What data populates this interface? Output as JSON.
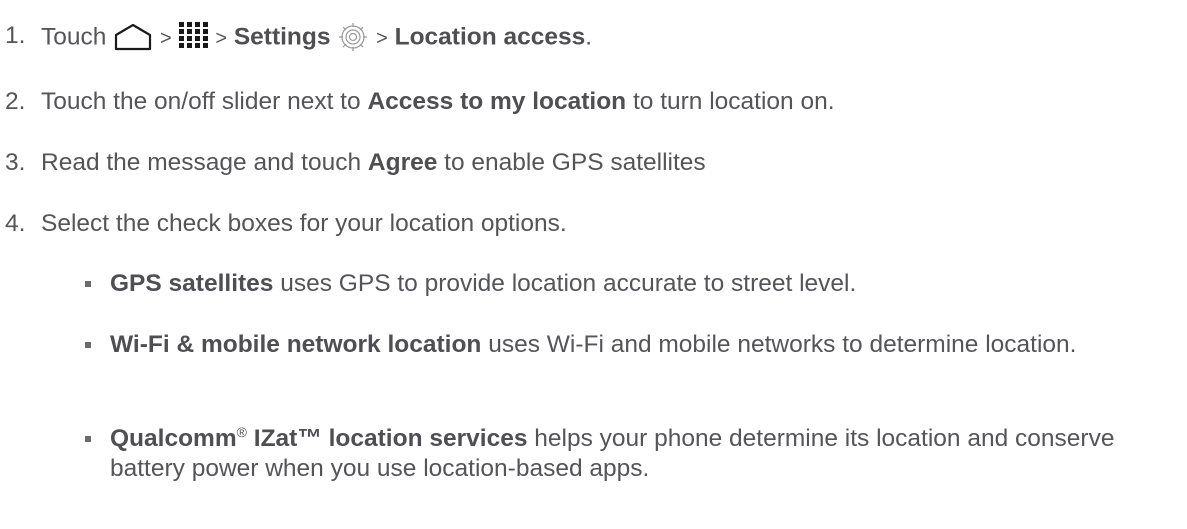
{
  "steps": [
    {
      "num": "1.",
      "touch": "Touch",
      "sep1": ">",
      "sep2": ">",
      "settings": "Settings",
      "sep3": ">",
      "location_access": "Location access",
      "end": ".",
      "icons": [
        "home-icon",
        "apps-grid-icon",
        "settings-gear-icon"
      ]
    },
    {
      "num": "2.",
      "pre": "Touch the on/off slider next to",
      "bold": "Access to my location",
      "post": "to turn location on."
    },
    {
      "num": "3.",
      "pre": "Read the message and touch",
      "bold": "Agree",
      "post": "to enable GPS satellites"
    },
    {
      "num": "4.",
      "text": "Select the check boxes for your location options."
    }
  ],
  "bullets": [
    {
      "bold": "GPS satellites",
      "text": "uses GPS to provide location accurate to street level."
    },
    {
      "bold": "Wi-Fi & mobile network location",
      "text": "uses Wi-Fi and mobile networks to determine location."
    },
    {
      "bold_a": "Qualcomm",
      "sup": "®",
      "bold_b": "IZat™ location services",
      "text": "helps your phone determine its location and conserve battery power when you use location-based apps."
    }
  ]
}
